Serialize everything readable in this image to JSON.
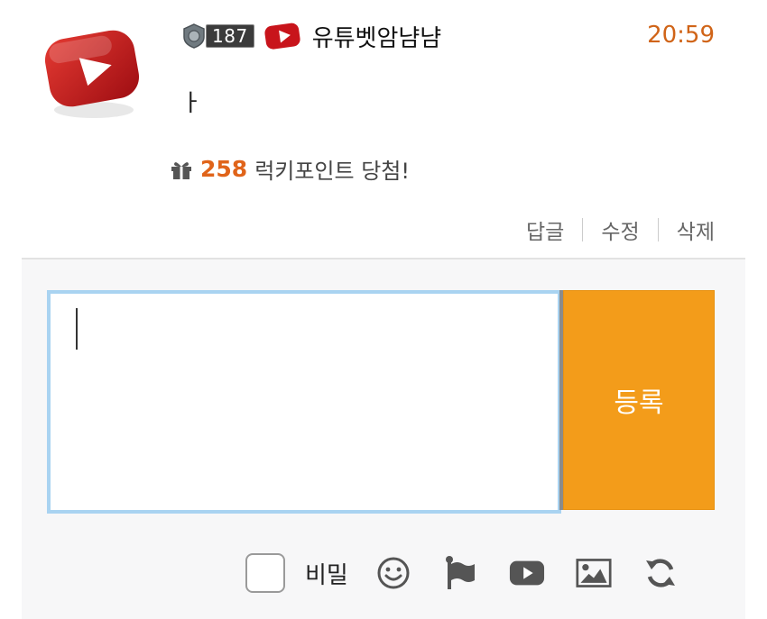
{
  "comment": {
    "level": "187",
    "nickname": "유튜벳암냠냠",
    "time": "20:59",
    "text": "ㅏ",
    "lucky_points": "258",
    "lucky_text": "럭키포인트 당첨!",
    "actions": [
      "답글",
      "수정",
      "삭제"
    ]
  },
  "form": {
    "textarea_value": "",
    "submit_label": "등록",
    "secret_label": "비밀",
    "secret_checked": false
  },
  "icons": {
    "gift": "gift-icon",
    "emoji": "smiley-icon",
    "flag": "flag-icon",
    "video": "youtube-icon",
    "image": "image-icon",
    "refresh": "refresh-icon"
  },
  "colors": {
    "accent": "#f39c1a",
    "time": "#d06418",
    "points": "#e0641a",
    "textarea_border": "#a9d3f1",
    "logo_red": "#c8141b"
  }
}
